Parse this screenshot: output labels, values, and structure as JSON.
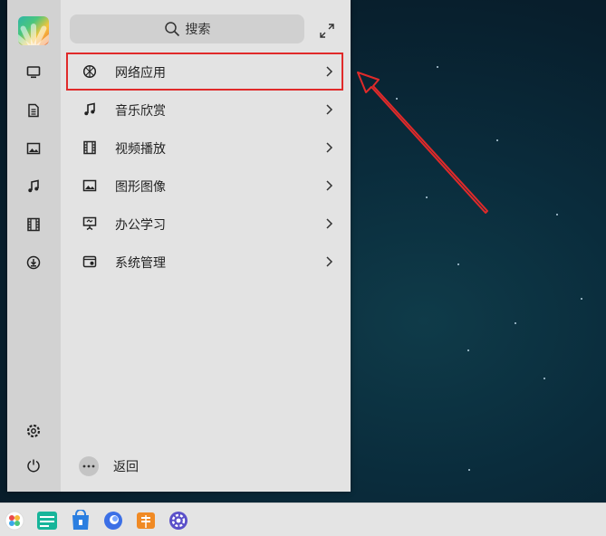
{
  "search": {
    "label": "搜索"
  },
  "categories": [
    {
      "label": "网络应用",
      "icon": "globe-icon",
      "highlighted": true
    },
    {
      "label": "音乐欣赏",
      "icon": "music-note-icon"
    },
    {
      "label": "视频播放",
      "icon": "film-icon"
    },
    {
      "label": "图形图像",
      "icon": "image-icon"
    },
    {
      "label": "办公学习",
      "icon": "presentation-icon"
    },
    {
      "label": "系统管理",
      "icon": "system-settings-icon"
    }
  ],
  "back": {
    "label": "返回"
  },
  "sidebar_icons": [
    "computer-icon",
    "document-icon",
    "image-icon",
    "music-icon",
    "film-icon",
    "download-icon",
    "settings-icon",
    "power-icon"
  ],
  "taskbar_icons": [
    "start-menu-icon",
    "file-manager-icon",
    "app-store-icon",
    "browser-icon",
    "package-icon",
    "settings-icon"
  ],
  "colors": {
    "highlight": "#e02a2a",
    "menu_bg": "#e3e3e3",
    "sidebar_bg": "#d2d2d2"
  }
}
